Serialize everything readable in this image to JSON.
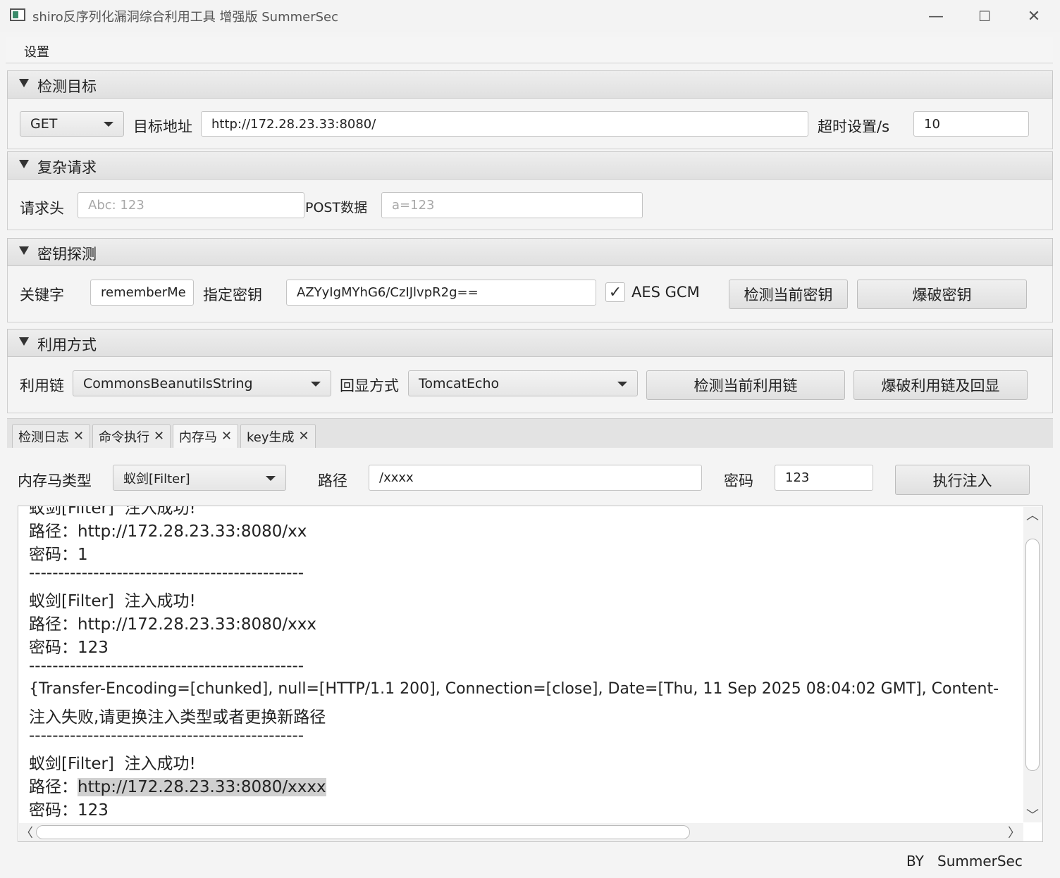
{
  "window": {
    "title": "shiro反序列化漏洞综合利用工具 增强版 SummerSec",
    "minimize": "—",
    "maximize": "☐",
    "close": "✕"
  },
  "menu": {
    "items": [
      "设置"
    ]
  },
  "target": {
    "section_title": "检测目标",
    "method": "GET",
    "url_label": "目标地址",
    "url_value": "http://172.28.23.33:8080/",
    "timeout_label": "超时设置/s",
    "timeout_value": "10"
  },
  "complex": {
    "section_title": "复杂请求",
    "header_label": "请求头",
    "header_placeholder": "Abc: 123",
    "post_label": "POST数据",
    "post_placeholder": "a=123"
  },
  "key": {
    "section_title": "密钥探测",
    "keyword_label": "关键字",
    "keyword_value": "rememberMe",
    "specified_label": "指定密钥",
    "key_value": "AZYyIgMYhG6/CzIJlvpR2g==",
    "aes_gcm_checked": true,
    "aes_gcm_label": "AES GCM",
    "check_btn": "检测当前密钥",
    "brute_btn": "爆破密钥"
  },
  "exploit": {
    "section_title": "利用方式",
    "chain_label": "利用链",
    "chain_value": "CommonsBeanutilsString",
    "echo_label": "回显方式",
    "echo_value": "TomcatEcho",
    "check_btn": "检测当前利用链",
    "brute_btn": "爆破利用链及回显"
  },
  "tabs": [
    {
      "label": "检测日志",
      "active": false
    },
    {
      "label": "命令执行",
      "active": false
    },
    {
      "label": "内存马",
      "active": true
    },
    {
      "label": "key生成",
      "active": false
    }
  ],
  "tab_close_glyph": "✕",
  "memshell": {
    "type_label": "内存马类型",
    "type_value": "蚁剑[Filter]",
    "path_label": "路径",
    "path_value": "/xxxx",
    "password_label": "密码",
    "password_value": "123",
    "inject_btn": "执行注入"
  },
  "log": {
    "lines": [
      "蚁剑[Filter]  注入成功!",
      "路径：http://172.28.23.33:8080/xx",
      "密码：1",
      "-----------------------------------------------",
      "蚁剑[Filter]  注入成功!",
      "路径：http://172.28.23.33:8080/xxx",
      "密码：123",
      "-----------------------------------------------",
      "{Transfer-Encoding=[chunked], null=[HTTP/1.1 200], Connection=[close], Date=[Thu, 11 Sep 2025 08:04:02 GMT], Content-",
      "注入失败,请更换注入类型或者更换新路径",
      "-----------------------------------------------",
      "蚁剑[Filter]  注入成功!",
      "路径：",
      "密码：123"
    ],
    "highlight_text": "http://172.28.23.33:8080/xxxx"
  },
  "scroll_glyphs": {
    "up": "︿",
    "down": "﹀",
    "left": "〈",
    "right": "〉"
  },
  "footer": {
    "by_label": "BY",
    "author": "SummerSec"
  }
}
